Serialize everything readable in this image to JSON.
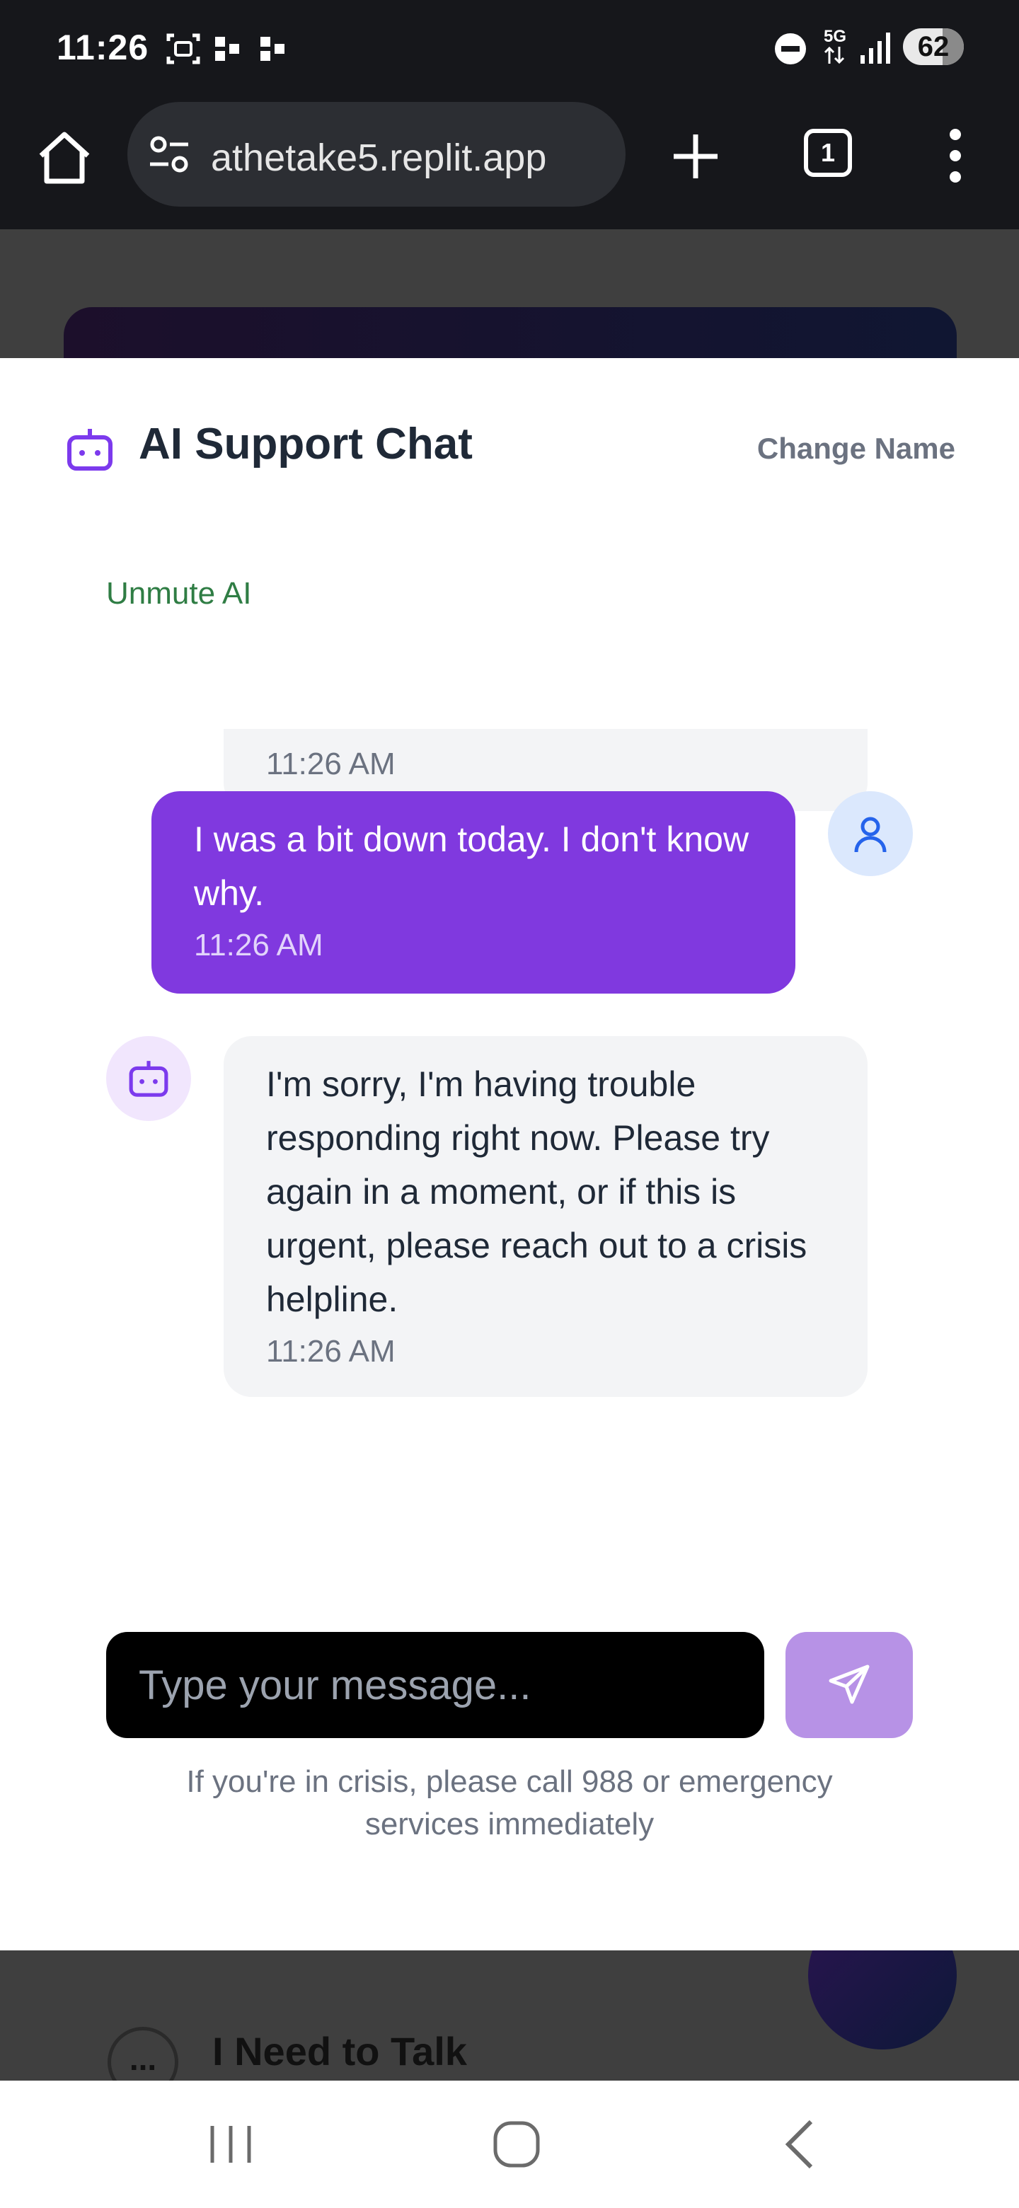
{
  "status_bar": {
    "time": "11:26",
    "network": "5G",
    "battery": "62"
  },
  "browser": {
    "url": "athetake5.replit.app",
    "tab_count": "1"
  },
  "background": {
    "bottom_title": "I Need to Talk",
    "dots": "..."
  },
  "chat": {
    "title": "AI Support Chat",
    "change_name_label": "Change Name",
    "unmute_label": "Unmute AI",
    "messages": [
      {
        "sender": "ai",
        "text": "",
        "time": "11:26 AM"
      },
      {
        "sender": "user",
        "text": "I was a bit down today. I don't know why.",
        "time": "11:26 AM"
      },
      {
        "sender": "ai",
        "text": "I'm sorry, I'm having trouble responding right now. Please try again in a moment, or if this is urgent, please reach out to a crisis helpline.",
        "time": "11:26 AM"
      }
    ],
    "input_placeholder": "Type your message...",
    "crisis_note": "If you're in crisis, please call 988 or emergency services immediately"
  },
  "colors": {
    "accent": "#8039df",
    "send_button": "#b792e6",
    "unmute": "#2f7d44"
  },
  "icons": [
    "home-icon",
    "tune-icon",
    "plus-icon",
    "tabs-icon",
    "more-vert-icon",
    "bot-icon",
    "user-icon",
    "send-icon",
    "recent-apps-icon",
    "home-nav-icon",
    "back-icon"
  ]
}
